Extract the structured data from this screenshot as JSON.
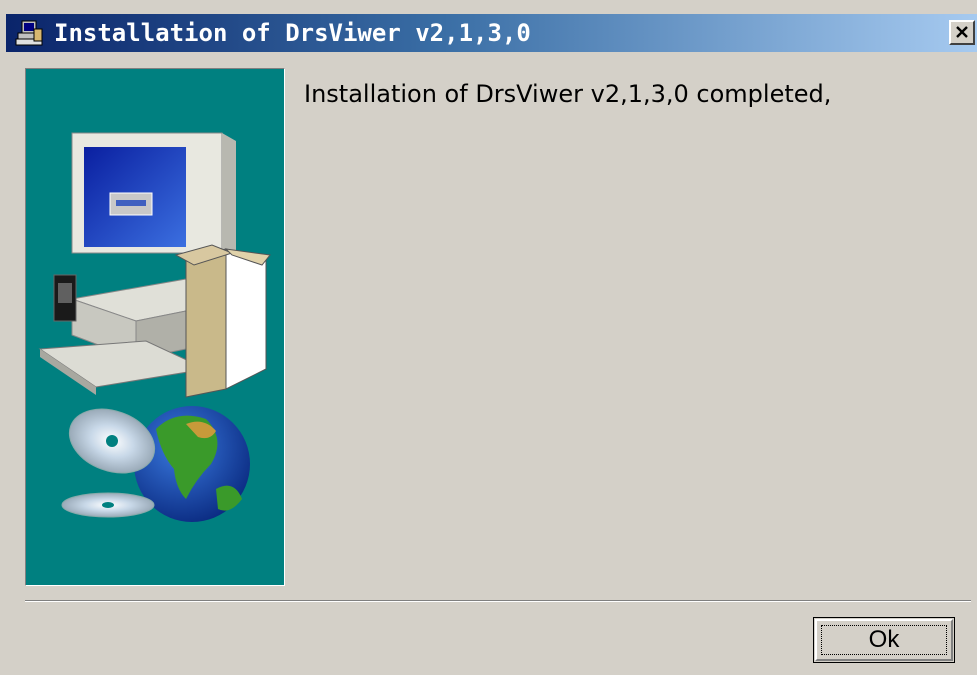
{
  "window": {
    "title": "Installation of DrsViwer v2,1,3,0",
    "title_icon": "setup-icon",
    "close_icon": "close-icon"
  },
  "content": {
    "message": "Installation of DrsViwer v2,1,3,0 completed,",
    "illustration": "computer-box-cd-globe-image"
  },
  "buttons": {
    "ok_label": "Ok"
  },
  "colors": {
    "title_start": "#0a246a",
    "title_end": "#a6caf0",
    "panel_bg": "#008080",
    "dialog_bg": "#d4d0c8"
  }
}
